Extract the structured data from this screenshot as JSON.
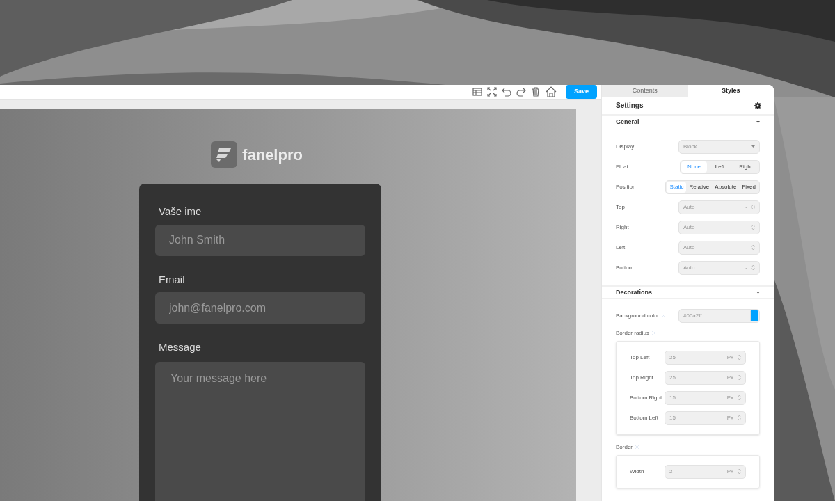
{
  "toolbar": {
    "save_button": "Save"
  },
  "brand": {
    "name": "fanelpro"
  },
  "form": {
    "fields": [
      {
        "label": "Vaše ime",
        "placeholder": "John Smith",
        "kind": "input"
      },
      {
        "label": "Email",
        "placeholder": "john@fanelpro.com",
        "kind": "input"
      },
      {
        "label": "Message",
        "placeholder": "Your message here",
        "kind": "textarea"
      }
    ]
  },
  "panel": {
    "tabs": [
      {
        "label": "Contents",
        "selected": false
      },
      {
        "label": "Styles",
        "selected": true
      }
    ],
    "settings_title": "Settings",
    "sections": [
      {
        "title": "General",
        "expanded": true,
        "properties": [
          {
            "kind": "select",
            "label": "Display",
            "value": "Block"
          },
          {
            "kind": "radio",
            "label": "Float",
            "options": [
              {
                "label": "None",
                "selected": true
              },
              {
                "label": "Left",
                "selected": false
              },
              {
                "label": "Right",
                "selected": false
              }
            ]
          },
          {
            "kind": "radio",
            "label": "Position",
            "options": [
              {
                "label": "Static",
                "selected": true
              },
              {
                "label": "Relative",
                "selected": false
              },
              {
                "label": "Absolute",
                "selected": false
              },
              {
                "label": "Fixed",
                "selected": false
              }
            ]
          },
          {
            "kind": "number",
            "label": "Top",
            "value": "Auto",
            "unit": "-"
          },
          {
            "kind": "number",
            "label": "Right",
            "value": "Auto",
            "unit": "-"
          },
          {
            "kind": "number",
            "label": "Left",
            "value": "Auto",
            "unit": "-"
          },
          {
            "kind": "number",
            "label": "Bottom",
            "value": "Auto",
            "unit": "-"
          }
        ]
      },
      {
        "title": "Decorations",
        "expanded": true,
        "properties": [
          {
            "kind": "color",
            "label": "Background color",
            "value": "#00a2ff",
            "color": "#00a2ff"
          },
          {
            "kind": "group",
            "label": "Border radius",
            "children": [
              {
                "label": "Top Left",
                "value": "25",
                "unit": "Px"
              },
              {
                "label": "Top Right",
                "value": "25",
                "unit": "Px"
              },
              {
                "label": "Bottom Right",
                "value": "15",
                "unit": "Px"
              },
              {
                "label": "Bottom Left",
                "value": "15",
                "unit": "Px"
              }
            ]
          },
          {
            "kind": "group",
            "label": "Border",
            "children": [
              {
                "label": "Width",
                "value": "2",
                "unit": "Px"
              }
            ]
          }
        ]
      }
    ]
  }
}
